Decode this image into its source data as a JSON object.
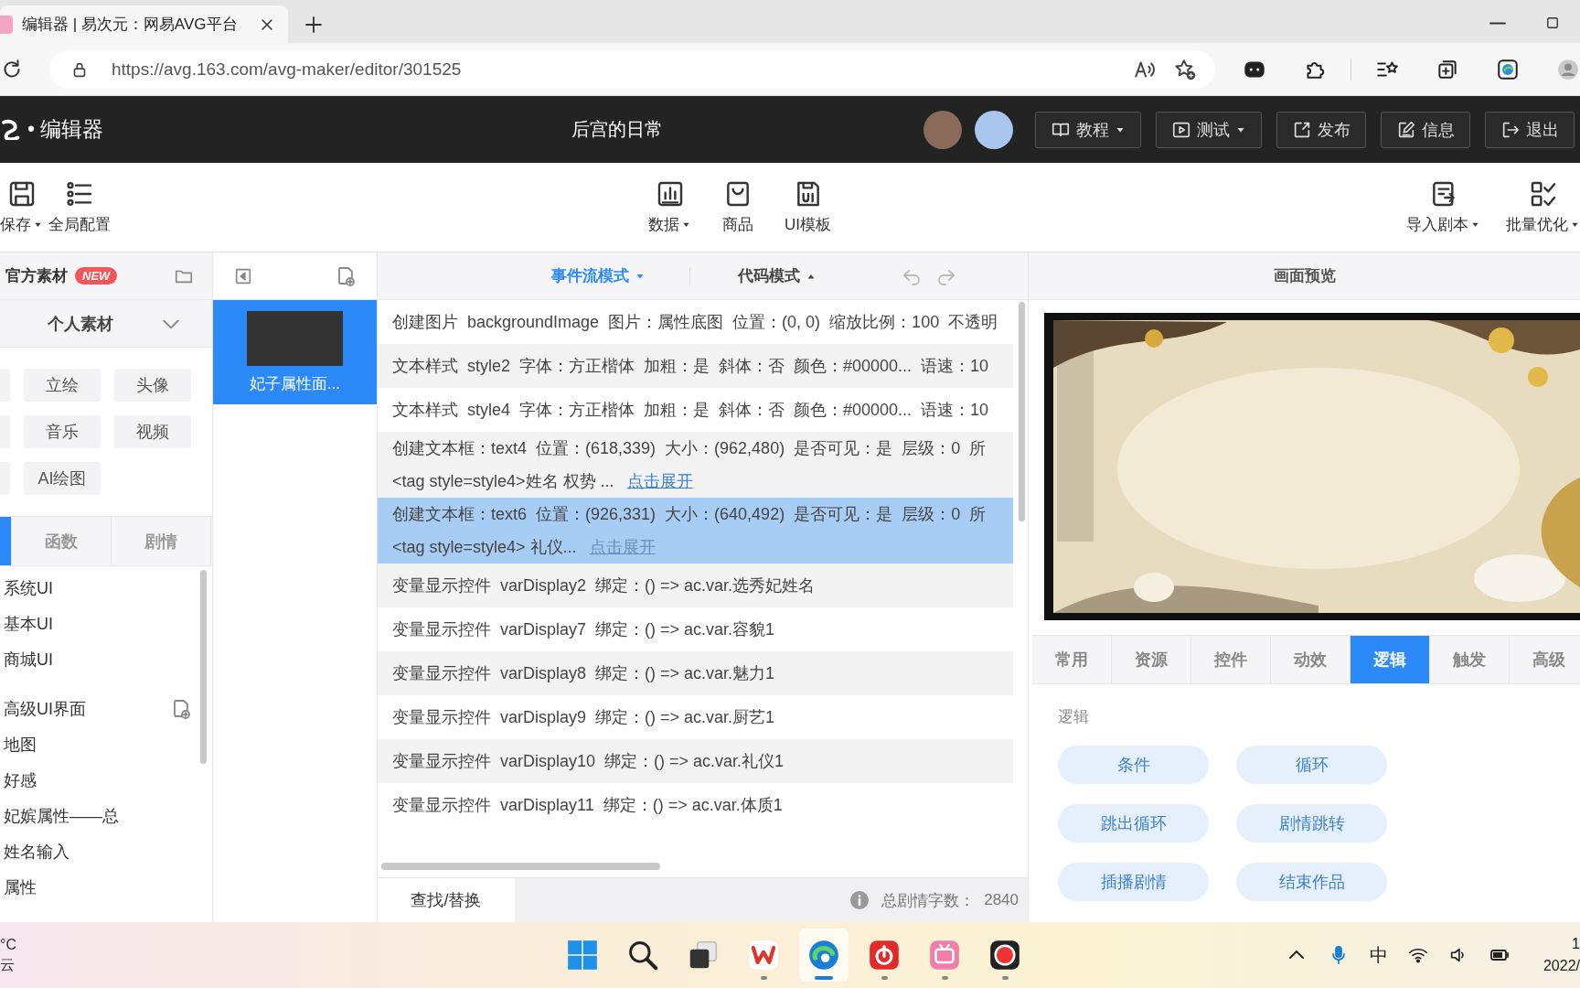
{
  "browser": {
    "tab": {
      "title": "编辑器 | 易次元：网易AVG平台"
    },
    "url": "https://avg.163.com/avg-maker/editor/301525"
  },
  "app_header": {
    "brand": "• 编辑器",
    "project_title": "后宫的日常",
    "buttons": [
      {
        "kind": "tutorial",
        "label": "教程",
        "dropdown": true
      },
      {
        "kind": "test",
        "label": "测试",
        "dropdown": true
      },
      {
        "kind": "publish",
        "label": "发布",
        "dropdown": false
      },
      {
        "kind": "info",
        "label": "信息",
        "dropdown": false
      },
      {
        "kind": "exit",
        "label": "退出",
        "dropdown": false
      }
    ]
  },
  "toolbar": {
    "left": [
      {
        "kind": "save",
        "label": "保存",
        "dropdown": true
      },
      {
        "kind": "config",
        "label": "全局配置",
        "dropdown": false
      }
    ],
    "center": [
      {
        "kind": "data",
        "label": "数据",
        "dropdown": true
      },
      {
        "kind": "shop",
        "label": "商品",
        "dropdown": false
      },
      {
        "kind": "template",
        "label": "UI模板",
        "dropdown": false
      }
    ],
    "right": [
      {
        "kind": "import",
        "label": "导入剧本",
        "dropdown": true
      },
      {
        "kind": "batch",
        "label": "批量优化",
        "dropdown": true
      }
    ]
  },
  "asset_panel": {
    "title": "官方素材",
    "badge": "NEW",
    "section": {
      "title": "个人素材",
      "expanded": true
    },
    "assets": [
      {
        "kind": "cut"
      },
      {
        "kind": "tile",
        "label": "立绘"
      },
      {
        "kind": "tile",
        "label": "头像"
      },
      {
        "kind": "cut"
      },
      {
        "kind": "tile",
        "label": "音乐"
      },
      {
        "kind": "tile",
        "label": "视频"
      },
      {
        "kind": "cut"
      },
      {
        "kind": "tile",
        "label": "AI绘图"
      }
    ],
    "tabs": [
      {
        "selected": true
      },
      {
        "label": "函数",
        "selected": false
      },
      {
        "label": "剧情",
        "selected": false
      }
    ],
    "tree": [
      {
        "label": "系统UI"
      },
      {
        "label": "基本UI"
      },
      {
        "label": "商城UI"
      },
      {
        "label": "高级UI界面",
        "add": true
      },
      {
        "label": "地图"
      },
      {
        "label": "好感"
      },
      {
        "label": "妃嫔属性——总"
      },
      {
        "label": "姓名输入"
      },
      {
        "label": "属性"
      }
    ]
  },
  "pages": [
    {
      "title": "妃子属性面...",
      "selected": true
    }
  ],
  "event_flow": {
    "modes": [
      {
        "label": "事件流模式",
        "selected": true
      },
      {
        "label": "代码模式",
        "selected": false
      }
    ],
    "rows": [
      {
        "text": "创建图片  backgroundImage  图片：属性底图  位置：(0, 0)  缩放比例：100  不透明",
        "selected": false
      },
      {
        "text": "文本样式  style2  字体：方正楷体  加粗：是  斜体：否  颜色：#00000...  语速：10",
        "selected": false
      },
      {
        "text": "文本样式  style4  字体：方正楷体  加粗：是  斜体：否  颜色：#00000...  语速：10",
        "selected": false
      },
      {
        "text": "创建文本框：text4  位置：(618,339)  大小：(962,480)  是否可见：是  层级：0  所",
        "detail": "<tag style=style4>姓名 权势 ...",
        "link": "点击展开",
        "selected": false
      },
      {
        "text": "创建文本框：text6  位置：(926,331)  大小：(640,492)  是否可见：是  层级：0  所",
        "detail": "<tag style=style4> 礼仪...",
        "link": "点击展开",
        "selected": true
      },
      {
        "text": "变量显示控件  varDisplay2  绑定：() => ac.var.选秀妃姓名",
        "selected": false
      },
      {
        "text": "变量显示控件  varDisplay7  绑定：() => ac.var.容貌1",
        "selected": false
      },
      {
        "text": "变量显示控件  varDisplay8  绑定：() => ac.var.魅力1",
        "selected": false
      },
      {
        "text": "变量显示控件  varDisplay9  绑定：() => ac.var.厨艺1",
        "selected": false
      },
      {
        "text": "变量显示控件  varDisplay10  绑定：() => ac.var.礼仪1",
        "selected": false
      },
      {
        "text": "变量显示控件  varDisplay11  绑定：() => ac.var.体质1",
        "selected": false
      }
    ],
    "footer": {
      "search_button": "查找/替换",
      "word_count_label": "总剧情字数：",
      "word_count": "2840"
    }
  },
  "preview": {
    "title": "画面预览"
  },
  "component_tabs": [
    {
      "label": "常用",
      "selected": false
    },
    {
      "label": "资源",
      "selected": false
    },
    {
      "label": "控件",
      "selected": false
    },
    {
      "label": "动效",
      "selected": false
    },
    {
      "label": "逻辑",
      "selected": true
    },
    {
      "label": "触发",
      "selected": false
    },
    {
      "label": "高级",
      "selected": false
    }
  ],
  "logic": {
    "title": "逻辑",
    "buttons": [
      "条件",
      "循环",
      "跳出循环",
      "剧情跳转",
      "插播剧情",
      "结束作品"
    ]
  },
  "taskbar": {
    "weather": {
      "temperature": "°C",
      "condition": "云"
    },
    "apps": [
      {
        "kind": "start",
        "running": false,
        "active": false
      },
      {
        "kind": "search",
        "running": false,
        "active": false
      },
      {
        "kind": "taskview",
        "running": false,
        "active": false
      },
      {
        "kind": "office",
        "running": true,
        "active": false
      },
      {
        "kind": "browser",
        "running": true,
        "active": true
      },
      {
        "kind": "music",
        "running": true,
        "active": false
      },
      {
        "kind": "video",
        "running": true,
        "active": false
      },
      {
        "kind": "recorder",
        "running": true,
        "active": false
      }
    ],
    "tray": {
      "ime": "中",
      "time": "1",
      "date": "2022/"
    }
  }
}
